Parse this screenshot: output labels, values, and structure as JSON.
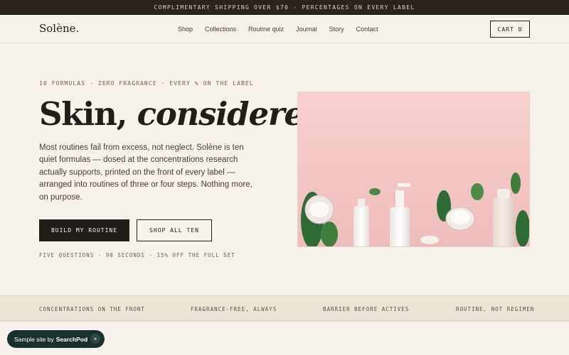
{
  "announcement": "COMPLIMENTARY SHIPPING OVER $70 · PERCENTAGES ON EVERY LABEL",
  "nav": {
    "logo": "Solène.",
    "links": [
      "Shop",
      "Collections",
      "Routine quiz",
      "Journal",
      "Story",
      "Contact"
    ],
    "cart": "CART 0"
  },
  "hero": {
    "eyebrow": "10 FORMULAS · ZERO FRAGRANCE · EVERY % ON THE LABEL",
    "headline_plain": "Skin,",
    "headline_italic": "considered.",
    "description": "Most routines fail from excess, not neglect. Solène is ten quiet formulas — dosed at the concentrations research actually supports, printed on the front of every label — arranged into routines of three or four steps. Nothing more, on purpose.",
    "primary_cta": "BUILD MY ROUTINE",
    "secondary_cta": "SHOP ALL TEN",
    "note": "FIVE QUESTIONS · 90 SECONDS · 15% OFF THE FULL SET"
  },
  "values": [
    "CONCENTRATIONS ON THE FRONT",
    "FRAGRANCE-FREE, ALWAYS",
    "BARRIER BEFORE ACTIVES",
    "ROUTINE, NOT REGIMEN"
  ],
  "badge": {
    "prefix": "Sample site by",
    "brand": "SearchPod",
    "close": "×"
  },
  "colors": {
    "background": "#f7f2eb",
    "dark": "#231d19",
    "accent": "#8a5a3c",
    "image_pink": "#f3c7c6"
  }
}
